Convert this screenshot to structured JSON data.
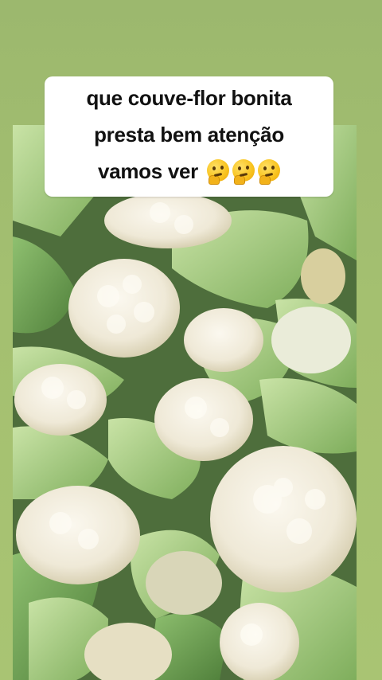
{
  "caption": {
    "line1": "que couve-flor bonita",
    "line2": "presta bem atenção",
    "line3": "vamos ver"
  },
  "emojis": [
    "thinking-face-icon",
    "thinking-face-icon",
    "thinking-face-icon"
  ],
  "colors": {
    "background": "#a4c070",
    "caption_bg": "#ffffff",
    "cauliflower_curd": "#f3eee0",
    "leaf": "#a9cf86"
  }
}
